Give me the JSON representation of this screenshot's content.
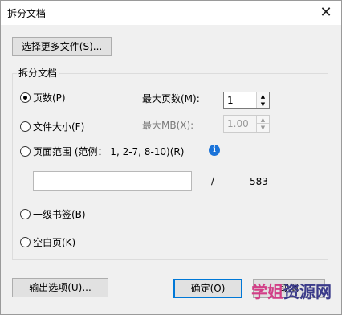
{
  "window": {
    "title": "拆分文档",
    "close_glyph": "✕"
  },
  "buttons": {
    "select_files": "选择更多文件(S)...",
    "output_options": "输出选项(U)...",
    "ok": "确定(O)",
    "cancel": "取消"
  },
  "group": {
    "label": "拆分文档",
    "options": {
      "pages": {
        "label": "页数(P)",
        "checked": true
      },
      "file_size": {
        "label": "文件大小(F)",
        "checked": false
      },
      "page_range": {
        "label": "页面范围 (范例： 1, 2-7, 8-10)(R)",
        "checked": false
      },
      "bookmarks": {
        "label": "一级书签(B)",
        "checked": false
      },
      "blank_page": {
        "label": "空白页(K)",
        "checked": false
      }
    },
    "max_pages": {
      "label": "最大页数(M):",
      "value": "1"
    },
    "max_mb": {
      "label": "最大MB(X):",
      "value": "1.00"
    },
    "range": {
      "value": "",
      "separator": "/",
      "total": "583"
    }
  },
  "icons": {
    "info": "info-icon",
    "close": "close-icon"
  },
  "watermark": {
    "part1": "学姐",
    "part2": "资源网"
  },
  "colors": {
    "accent": "#0078d7",
    "info": "#1a73d9"
  }
}
